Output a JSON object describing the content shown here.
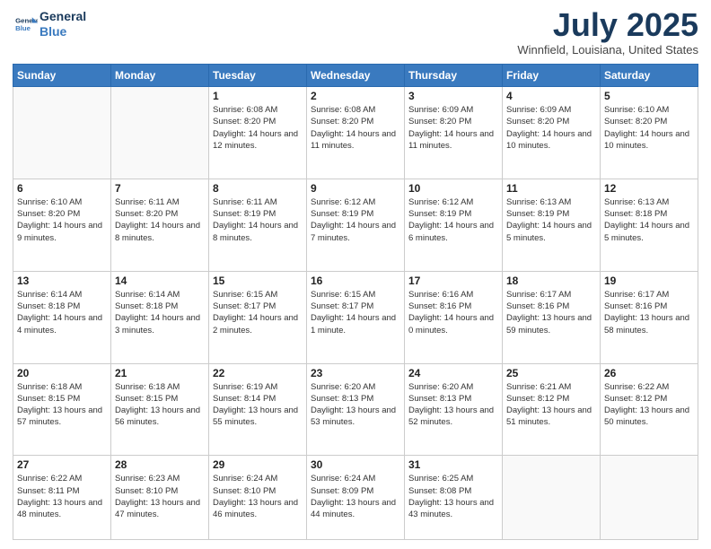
{
  "header": {
    "logo_line1": "General",
    "logo_line2": "Blue",
    "month_title": "July 2025",
    "location": "Winnfield, Louisiana, United States"
  },
  "days_of_week": [
    "Sunday",
    "Monday",
    "Tuesday",
    "Wednesday",
    "Thursday",
    "Friday",
    "Saturday"
  ],
  "weeks": [
    [
      {
        "day": "",
        "info": ""
      },
      {
        "day": "",
        "info": ""
      },
      {
        "day": "1",
        "info": "Sunrise: 6:08 AM\nSunset: 8:20 PM\nDaylight: 14 hours and 12 minutes."
      },
      {
        "day": "2",
        "info": "Sunrise: 6:08 AM\nSunset: 8:20 PM\nDaylight: 14 hours and 11 minutes."
      },
      {
        "day": "3",
        "info": "Sunrise: 6:09 AM\nSunset: 8:20 PM\nDaylight: 14 hours and 11 minutes."
      },
      {
        "day": "4",
        "info": "Sunrise: 6:09 AM\nSunset: 8:20 PM\nDaylight: 14 hours and 10 minutes."
      },
      {
        "day": "5",
        "info": "Sunrise: 6:10 AM\nSunset: 8:20 PM\nDaylight: 14 hours and 10 minutes."
      }
    ],
    [
      {
        "day": "6",
        "info": "Sunrise: 6:10 AM\nSunset: 8:20 PM\nDaylight: 14 hours and 9 minutes."
      },
      {
        "day": "7",
        "info": "Sunrise: 6:11 AM\nSunset: 8:20 PM\nDaylight: 14 hours and 8 minutes."
      },
      {
        "day": "8",
        "info": "Sunrise: 6:11 AM\nSunset: 8:19 PM\nDaylight: 14 hours and 8 minutes."
      },
      {
        "day": "9",
        "info": "Sunrise: 6:12 AM\nSunset: 8:19 PM\nDaylight: 14 hours and 7 minutes."
      },
      {
        "day": "10",
        "info": "Sunrise: 6:12 AM\nSunset: 8:19 PM\nDaylight: 14 hours and 6 minutes."
      },
      {
        "day": "11",
        "info": "Sunrise: 6:13 AM\nSunset: 8:19 PM\nDaylight: 14 hours and 5 minutes."
      },
      {
        "day": "12",
        "info": "Sunrise: 6:13 AM\nSunset: 8:18 PM\nDaylight: 14 hours and 5 minutes."
      }
    ],
    [
      {
        "day": "13",
        "info": "Sunrise: 6:14 AM\nSunset: 8:18 PM\nDaylight: 14 hours and 4 minutes."
      },
      {
        "day": "14",
        "info": "Sunrise: 6:14 AM\nSunset: 8:18 PM\nDaylight: 14 hours and 3 minutes."
      },
      {
        "day": "15",
        "info": "Sunrise: 6:15 AM\nSunset: 8:17 PM\nDaylight: 14 hours and 2 minutes."
      },
      {
        "day": "16",
        "info": "Sunrise: 6:15 AM\nSunset: 8:17 PM\nDaylight: 14 hours and 1 minute."
      },
      {
        "day": "17",
        "info": "Sunrise: 6:16 AM\nSunset: 8:16 PM\nDaylight: 14 hours and 0 minutes."
      },
      {
        "day": "18",
        "info": "Sunrise: 6:17 AM\nSunset: 8:16 PM\nDaylight: 13 hours and 59 minutes."
      },
      {
        "day": "19",
        "info": "Sunrise: 6:17 AM\nSunset: 8:16 PM\nDaylight: 13 hours and 58 minutes."
      }
    ],
    [
      {
        "day": "20",
        "info": "Sunrise: 6:18 AM\nSunset: 8:15 PM\nDaylight: 13 hours and 57 minutes."
      },
      {
        "day": "21",
        "info": "Sunrise: 6:18 AM\nSunset: 8:15 PM\nDaylight: 13 hours and 56 minutes."
      },
      {
        "day": "22",
        "info": "Sunrise: 6:19 AM\nSunset: 8:14 PM\nDaylight: 13 hours and 55 minutes."
      },
      {
        "day": "23",
        "info": "Sunrise: 6:20 AM\nSunset: 8:13 PM\nDaylight: 13 hours and 53 minutes."
      },
      {
        "day": "24",
        "info": "Sunrise: 6:20 AM\nSunset: 8:13 PM\nDaylight: 13 hours and 52 minutes."
      },
      {
        "day": "25",
        "info": "Sunrise: 6:21 AM\nSunset: 8:12 PM\nDaylight: 13 hours and 51 minutes."
      },
      {
        "day": "26",
        "info": "Sunrise: 6:22 AM\nSunset: 8:12 PM\nDaylight: 13 hours and 50 minutes."
      }
    ],
    [
      {
        "day": "27",
        "info": "Sunrise: 6:22 AM\nSunset: 8:11 PM\nDaylight: 13 hours and 48 minutes."
      },
      {
        "day": "28",
        "info": "Sunrise: 6:23 AM\nSunset: 8:10 PM\nDaylight: 13 hours and 47 minutes."
      },
      {
        "day": "29",
        "info": "Sunrise: 6:24 AM\nSunset: 8:10 PM\nDaylight: 13 hours and 46 minutes."
      },
      {
        "day": "30",
        "info": "Sunrise: 6:24 AM\nSunset: 8:09 PM\nDaylight: 13 hours and 44 minutes."
      },
      {
        "day": "31",
        "info": "Sunrise: 6:25 AM\nSunset: 8:08 PM\nDaylight: 13 hours and 43 minutes."
      },
      {
        "day": "",
        "info": ""
      },
      {
        "day": "",
        "info": ""
      }
    ]
  ]
}
